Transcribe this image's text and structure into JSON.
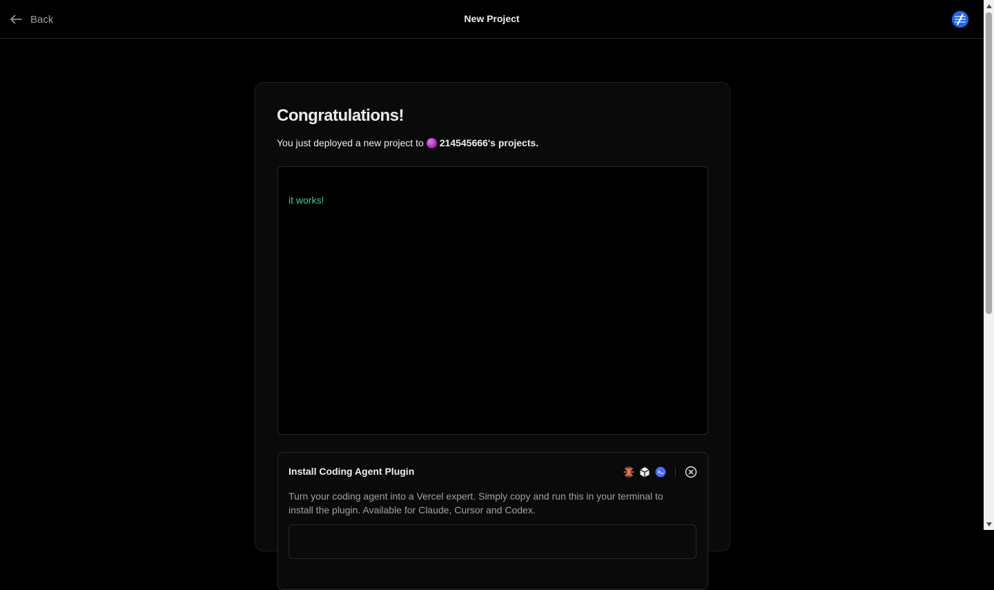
{
  "header": {
    "back_label": "Back",
    "title": "New Project"
  },
  "card": {
    "heading": "Congratulations!",
    "deployed_prefix": "You just deployed a new project to",
    "team_name": "214545666's projects."
  },
  "preview": {
    "text": "it works!",
    "text_color": "#3ecf8e"
  },
  "plugin": {
    "title": "Install Coding Agent Plugin",
    "description": "Turn your coding agent into a Vercel expert. Simply copy and run this in your terminal to install the plugin. Available for Claude, Cursor and Codex.",
    "agent_icons": [
      "claude-icon",
      "cursor-icon",
      "codex-icon"
    ]
  },
  "colors": {
    "background": "#000000",
    "card": "#0a0a0a",
    "accent_green": "#3ecf8e",
    "claude_orange": "#d97757",
    "codex_blue": "#4f6cf7"
  }
}
